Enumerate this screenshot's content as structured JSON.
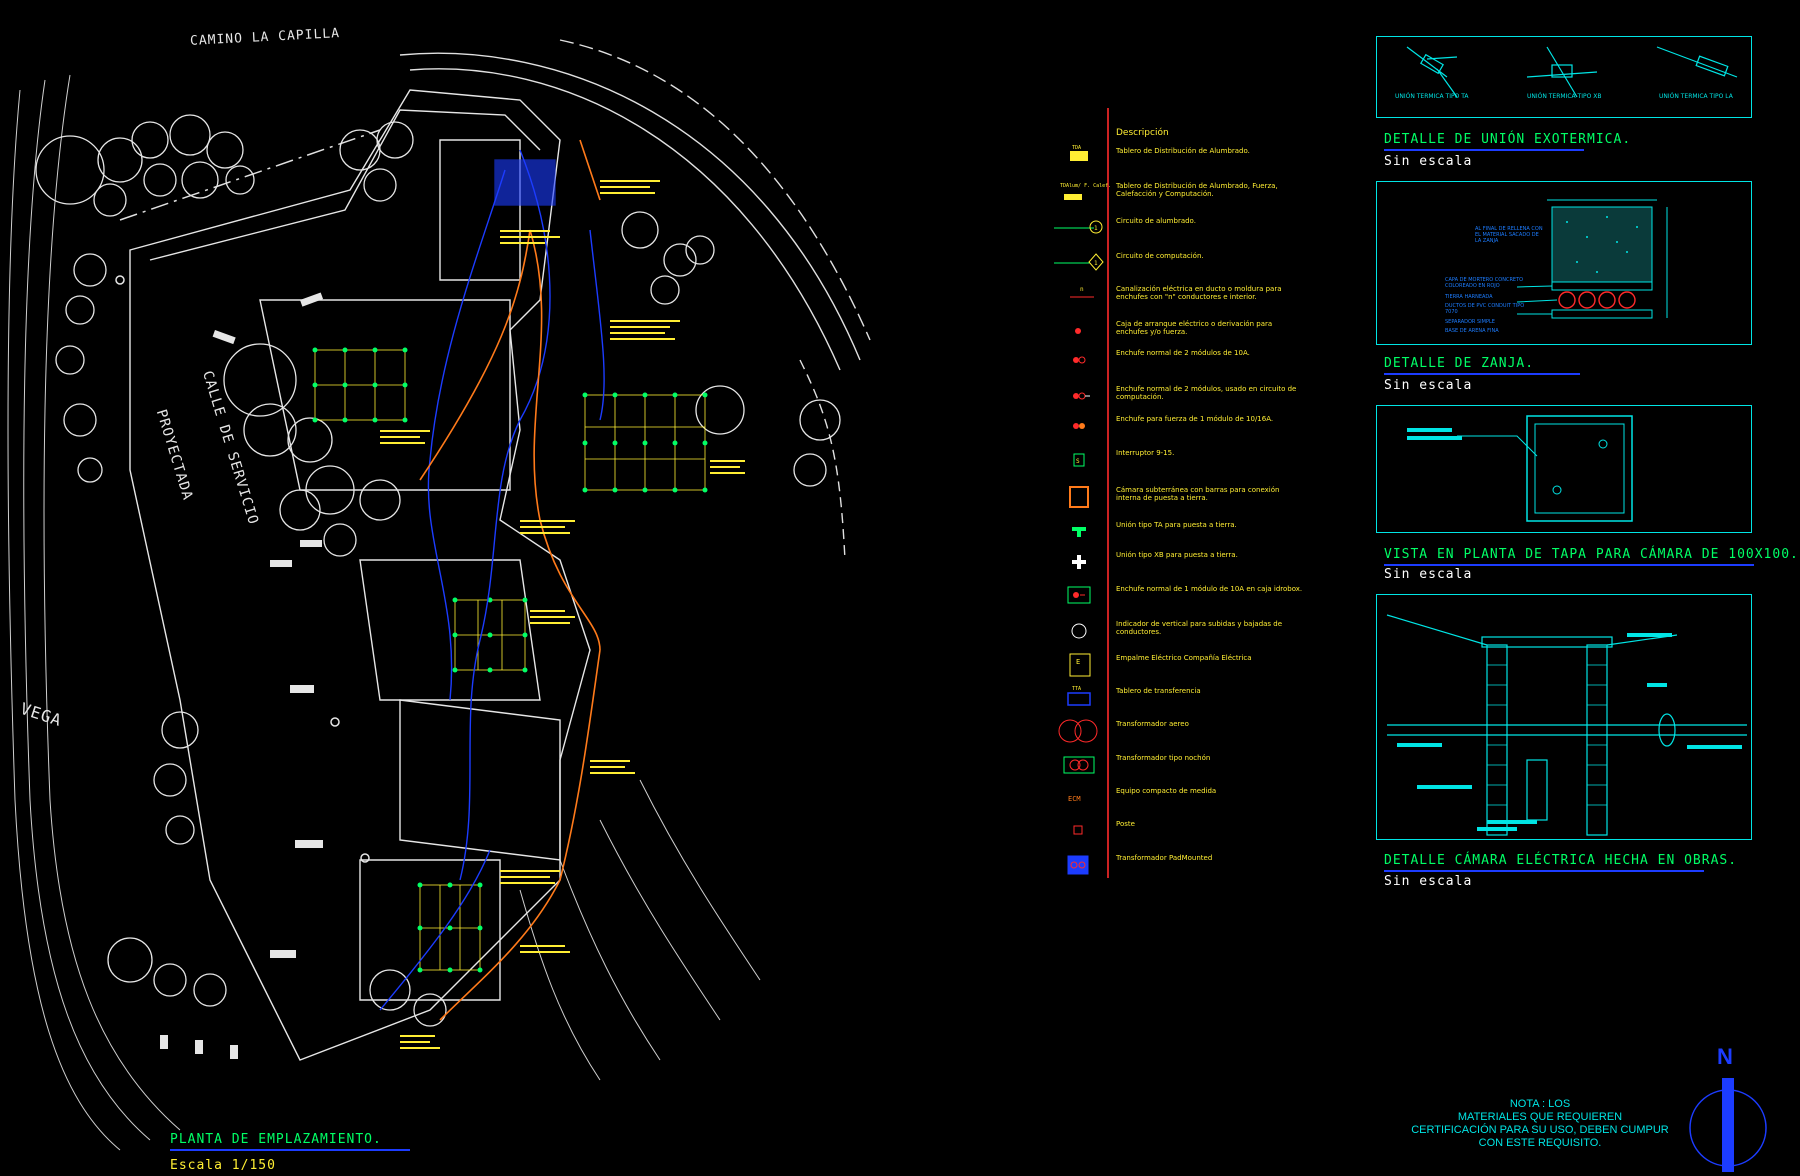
{
  "site_plan": {
    "road_label": "CAMINO LA CAPILLA",
    "street_label_1": "CALLE DE SERVICIO",
    "street_label_2": "PROYECTADA",
    "vega_label": "VEGA",
    "title": "PLANTA DE EMPLAZAMIENTO.",
    "scale": "Escala 1/150"
  },
  "legend": {
    "header": "Descripción",
    "items": [
      {
        "symbol": "tda-box",
        "tag": "TDA",
        "text": "Tablero de Distribución de Alumbrado."
      },
      {
        "symbol": "tda-combo",
        "tag": "TDAlum/ F. Calef. y Comp.",
        "text": "Tablero de Distribución de Alumbrado, Fuerza, Calefacción y Computación."
      },
      {
        "symbol": "circuit-lighting",
        "tag": "1",
        "text": "Circuito de alumbrado."
      },
      {
        "symbol": "circuit-computing",
        "tag": "1",
        "text": "Circuito de computación."
      },
      {
        "symbol": "duct",
        "tag": "n",
        "text": "Canalización eléctrica en ducto o moldura para enchufes con \"n\" conductores e interior."
      },
      {
        "symbol": "junction-box",
        "tag": "",
        "text": "Caja de arranque eléctrico o derivación para enchufes y/o fuerza."
      },
      {
        "symbol": "outlet-2",
        "tag": "",
        "text": "Enchufe normal de 2 módulos de 10A."
      },
      {
        "symbol": "outlet-comp",
        "tag": "",
        "text": "Enchufe normal de 2 módulos, usado en circuito de computación."
      },
      {
        "symbol": "outlet-power",
        "tag": "",
        "text": "Enchufe para fuerza de 1 módulo de 10/16A."
      },
      {
        "symbol": "switch",
        "tag": "",
        "text": "Interruptor 9-15."
      },
      {
        "symbol": "chamber",
        "tag": "",
        "text": "Cámara subterránea con barras para conexión interna de puesta a tierra."
      },
      {
        "symbol": "union-ta",
        "tag": "",
        "text": "Unión tipo TA para puesta a tierra."
      },
      {
        "symbol": "union-xb",
        "tag": "",
        "text": "Unión tipo XB para puesta a tierra."
      },
      {
        "symbol": "outlet-box",
        "tag": "",
        "text": "Enchufe normal de 1 módulo de 10A en caja idrobox."
      },
      {
        "symbol": "vertical",
        "tag": "",
        "text": "Indicador de vertical para subidas y bajadas de conductores."
      },
      {
        "symbol": "empalme",
        "tag": "E",
        "text": "Empalme Eléctrico Compañía Eléctrica"
      },
      {
        "symbol": "transfer",
        "tag": "TTA",
        "text": "Tablero de transferencia"
      },
      {
        "symbol": "transformer-aereo",
        "tag": "",
        "text": "Transformador aereo"
      },
      {
        "symbol": "transformer-nocha",
        "tag": "",
        "text": "Transformador tipo nochón"
      },
      {
        "symbol": "meter",
        "tag": "ECM",
        "text": "Equipo compacto de medida"
      },
      {
        "symbol": "pole",
        "tag": "",
        "text": "Poste"
      },
      {
        "symbol": "padmounted",
        "tag": "",
        "text": "Transformador PadMounted"
      }
    ]
  },
  "details": {
    "exotermica": {
      "title": "DETALLE DE UNIÓN EXOTERMICA.",
      "scale": "Sin escala",
      "labels": [
        "UNIÓN TERMICA TIPO TA",
        "UNIÓN TERMICA TIPO XB",
        "UNIÓN TERMICA TIPO LA"
      ]
    },
    "zanja": {
      "title": "DETALLE DE ZANJA.",
      "scale": "Sin escala",
      "labels": [
        "AL FINAL DE RELLENA CON EL MATERIAL SACADO DE LA ZANJA",
        "CAPA DE MORTERO CONCRETO COLOREADO EN ROJO",
        "TIERRA HARNEADA",
        "DUCTOS DE PVC CONDUIT TIPO 7070",
        "SEPARADOR SIMPLE",
        "BASE DE ARENA FINA"
      ]
    },
    "tapa": {
      "title": "VISTA EN PLANTA DE TAPA PARA CÁMARA DE 100X100.",
      "scale": "Sin escala"
    },
    "camara": {
      "title": "DETALLE CÁMARA ELÉCTRICA HECHA EN OBRAS.",
      "scale": "Sin escala"
    }
  },
  "note": {
    "line1": "NOTA : LOS",
    "line2": "MATERIALES QUE REQUIEREN",
    "line3": "CERTIFICACIÓN PARA SU USO, DEBEN CUMPUR",
    "line4": "CON ESTE REQUISITO."
  },
  "north": {
    "label": "N"
  },
  "colors": {
    "lines": "#d9d9d9",
    "yellow": "#ffee33",
    "green": "#00ff66",
    "cyan": "#00e5e5",
    "blue": "#1c3cff",
    "orange": "#ff7a1a",
    "red": "#ff2a2a"
  }
}
